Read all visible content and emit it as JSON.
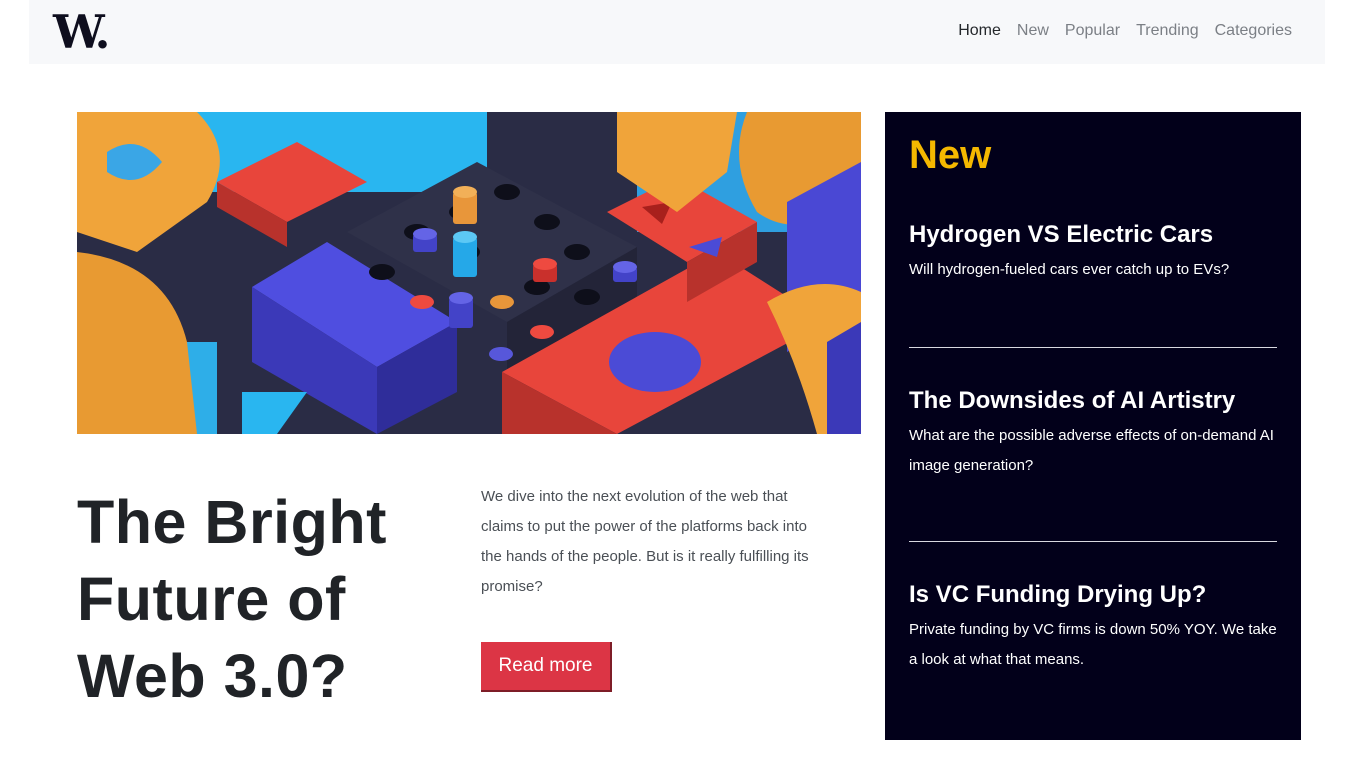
{
  "brand": {
    "logo_text": "W."
  },
  "nav": {
    "items": [
      {
        "label": "Home",
        "active": true
      },
      {
        "label": "New",
        "active": false
      },
      {
        "label": "Popular",
        "active": false
      },
      {
        "label": "Trending",
        "active": false
      },
      {
        "label": "Categories",
        "active": false
      }
    ]
  },
  "hero": {
    "image": "abstract-3d-blocks-illustration",
    "title": "The Bright Future of Web 3.0?",
    "description": "We dive into the next evolution of the web that claims to put the power of the platforms back into the hands of the people. But is it really fulfilling its promise?",
    "cta_label": "Read more"
  },
  "sidebar": {
    "heading": "New",
    "items": [
      {
        "title": "Hydrogen VS Electric Cars",
        "summary": "Will hydrogen-fueled cars ever catch up to EVs?"
      },
      {
        "title": "The Downsides of AI Artistry",
        "summary": "What are the possible adverse effects of on-demand AI image generation?"
      },
      {
        "title": "Is VC Funding Drying Up?",
        "summary": "Private funding by VC firms is down 50% YOY. We take a look at what that means."
      }
    ]
  },
  "colors": {
    "accent_yellow": "#f5b800",
    "cta_red": "#dc3545",
    "sidebar_bg": "#02001a"
  }
}
